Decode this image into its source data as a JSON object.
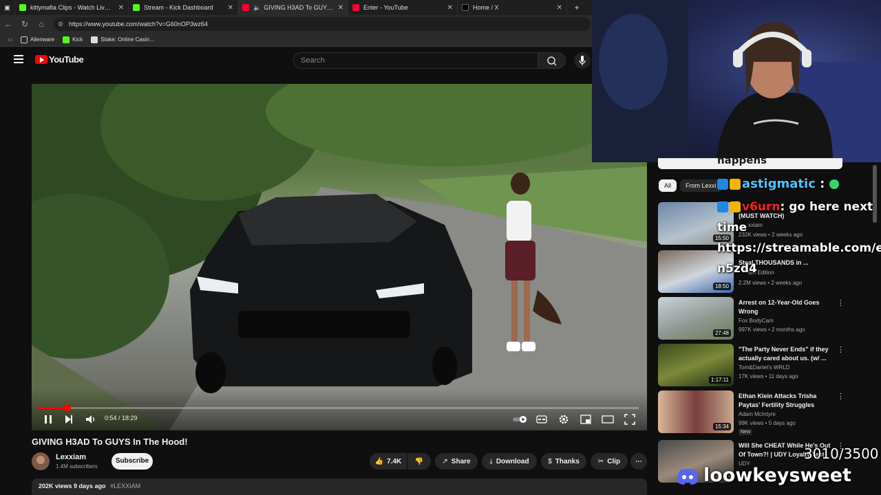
{
  "browser": {
    "tabs": [
      {
        "title": "kittymafia Clips - Watch Live on K",
        "color": "#53fc18"
      },
      {
        "title": "Stream - Kick Dashboard",
        "color": "#53fc18"
      },
      {
        "title": "GIVING H3AD To GUYS In Th",
        "color": "#ff0033",
        "active": true
      },
      {
        "title": "Enter - YouTube",
        "color": "#ff0033"
      },
      {
        "title": "Home / X",
        "color": "#000000"
      }
    ],
    "url": "https://www.youtube.com/watch?v=G60nOP3wz64",
    "bookmarks": [
      "Alienware",
      "Kick",
      "Stake: Online Casin..."
    ]
  },
  "youtube": {
    "logo_text": "YouTube",
    "search_placeholder": "Search",
    "video": {
      "time_current": "0:54",
      "time_total": "18:29",
      "progress_fraction": 0.049,
      "title": "GIVING H3AD To GUYS In The Hood!",
      "channel": "Lexxiam",
      "subscribers": "1.4M subscribers",
      "subscribe_label": "Subscribe",
      "likes": "7.4K",
      "share_label": "Share",
      "download_label": "Download",
      "thanks_label": "Thanks",
      "clip_label": "Clip",
      "meta_views": "202K views  9 days ago",
      "meta_hashtag": "#LEXXIAM"
    },
    "chips": [
      "All",
      "From Lexxi"
    ],
    "recommendations": [
      {
        "title": "(MUST WATCH)",
        "channel": "xxiam",
        "views": "232K views • 2 weeks ago",
        "duration": "15:50"
      },
      {
        "title": "Steal THOUSANDS in ...",
        "channel": "am Edition",
        "views": "2.2M views • 2 weeks ago",
        "duration": "18:50"
      },
      {
        "title": "Arrest on 12-Year-Old Goes Wrong",
        "channel": "Fox BodyCam",
        "views": "997K views • 2 months ago",
        "duration": "27:48"
      },
      {
        "title": "\"The Party Never Ends\" if they actually cared about us. (w/ ...",
        "channel": "Tom&Daniel's WRLD",
        "views": "17K views • 11 days ago",
        "duration": "1:17:11"
      },
      {
        "title": "Ethan Klein Attacks Trisha Paytas' Fertility Struggles",
        "channel": "Adam McIntyre",
        "views": "99K views • 5 days ago",
        "duration": "15:34",
        "badge": "New"
      },
      {
        "title": "Will She CHEAT While He's Out Of Town?! | UDY Loyalty Test",
        "channel": "UDY",
        "views": "",
        "duration": ""
      }
    ]
  },
  "overlay": {
    "chat_top": "happens",
    "chat_user1": "astigmatic",
    "chat_user2": "v6urn",
    "chat_msg2_a": ": go here next",
    "chat_msg2_b": "time",
    "chat_link_a": "https://streamable.com/e",
    "chat_link_b": "n5zd4",
    "goal": "3010/3500",
    "discord": "loowkeysweet"
  },
  "colors": {
    "youtube_red": "#ff0000",
    "kick_green": "#53fc18",
    "chat_user1": "#4fc3ff",
    "chat_user2": "#ff2020",
    "discord_blurple": "#5865f2"
  }
}
